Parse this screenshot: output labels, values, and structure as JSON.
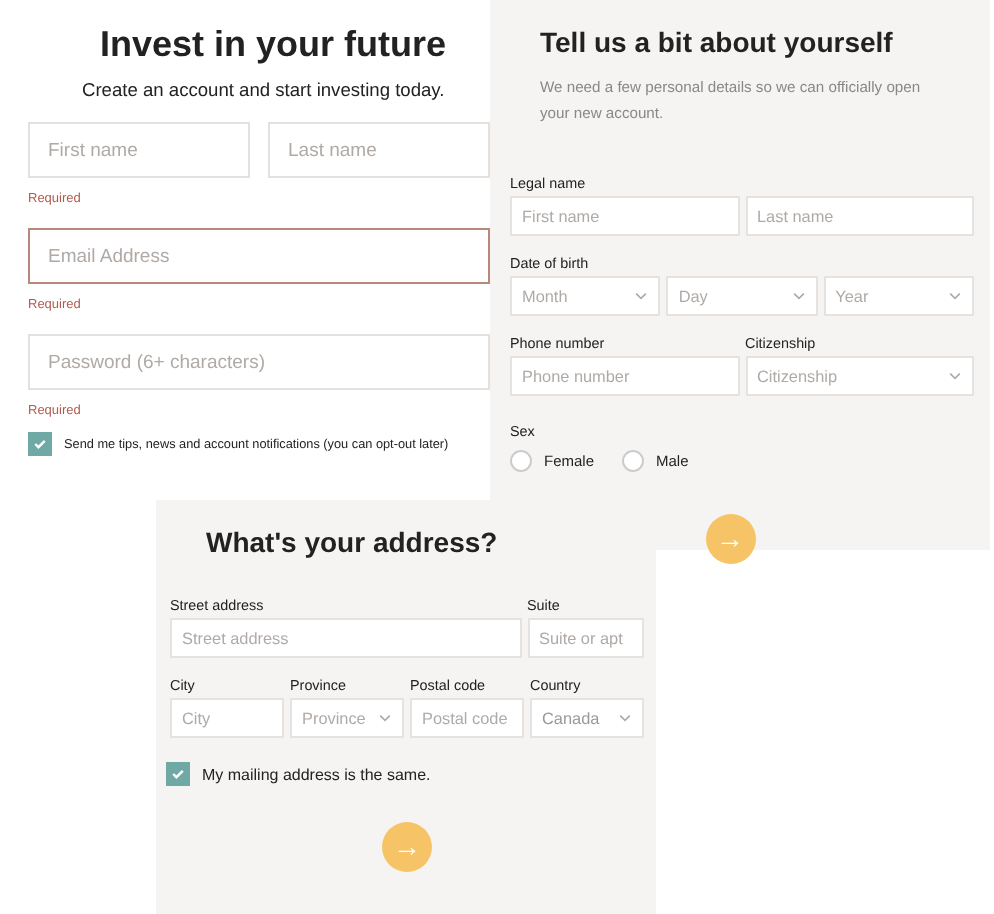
{
  "signup": {
    "title": "Invest in your future",
    "subtitle": "Create an account and start investing today.",
    "fields": [
      {
        "placeholder": "First name",
        "error": false
      },
      {
        "placeholder": "Last name",
        "error": false
      },
      {
        "placeholder": "Email Address",
        "error": true
      },
      {
        "placeholder": "Password (6+ characters)",
        "error": false
      }
    ],
    "required": [
      "Required",
      "Required",
      "Required"
    ],
    "consent": {
      "label": "Send me tips, news and account notifications (you can opt-out later)",
      "checked": true
    }
  },
  "about": {
    "title": "Tell us a bit about yourself",
    "description": "We need a few personal details so we can officially open your new account.",
    "legal_name": {
      "label": "Legal name",
      "first_placeholder": "First name",
      "last_placeholder": "Last name"
    },
    "birth": {
      "label": "Date of birth",
      "selects": [
        "Month",
        "Day",
        "Year"
      ]
    },
    "phone": {
      "label": "Phone number",
      "placeholder": "Phone number"
    },
    "citizenship": {
      "label": "Citizenship",
      "placeholder": "Citizenship"
    },
    "sex": {
      "label": "Sex",
      "options": [
        {
          "label": "Female",
          "selected": false
        },
        {
          "label": "Male",
          "selected": false
        }
      ]
    },
    "next": "→"
  },
  "address": {
    "title": "What's your address?",
    "street": {
      "label": "Street address",
      "placeholder": "Street address"
    },
    "suite": {
      "label": "Suite",
      "placeholder": "Suite or apt"
    },
    "row": [
      {
        "kind": "input",
        "label": "City",
        "placeholder": "City"
      },
      {
        "kind": "select",
        "label": "Province",
        "placeholder": "Province"
      },
      {
        "kind": "input",
        "label": "Postal code",
        "placeholder": "Postal code"
      },
      {
        "kind": "select",
        "label": "Country",
        "value": "Canada"
      }
    ],
    "same": {
      "label": "My mailing address is the same.",
      "checked": true
    },
    "next": "→"
  }
}
